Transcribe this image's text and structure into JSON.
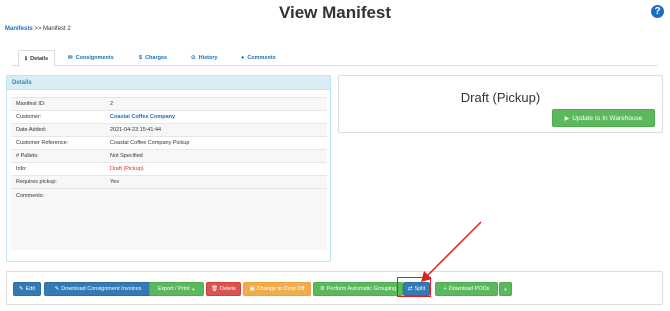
{
  "header": {
    "title": "View Manifest",
    "help_icon": "?"
  },
  "breadcrumb": {
    "link": "Manifests",
    "separator": ">>",
    "current": "Manifest 2"
  },
  "tabs": [
    {
      "label": "Details",
      "icon": "info-icon",
      "glyph": "ℹ",
      "active": true
    },
    {
      "label": "Consignments",
      "icon": "envelope-icon",
      "glyph": "✉",
      "active": false
    },
    {
      "label": "Charges",
      "icon": "dollar-icon",
      "glyph": "$",
      "active": false
    },
    {
      "label": "History",
      "icon": "clock-icon",
      "glyph": "⊙",
      "active": false
    },
    {
      "label": "Comments",
      "icon": "comment-icon",
      "glyph": "●",
      "active": false
    }
  ],
  "details": {
    "heading": "Details",
    "rows": [
      {
        "label": "Manifest ID:",
        "value": "2"
      },
      {
        "label": "Customer:",
        "value": "Coastal Coffee Company"
      },
      {
        "label": "Date Added:",
        "value": "2021-04-23 15:41:44"
      },
      {
        "label": "Customer Reference:",
        "value": "Coastal Coffee Company Pickup"
      },
      {
        "label": "# Pallets:",
        "value": "Not Specified"
      },
      {
        "label": "Info:",
        "value": "Draft (Pickup)"
      },
      {
        "label": "Requires pickup:",
        "value": "Yes"
      }
    ],
    "comments_label": "Comments:"
  },
  "status": {
    "text": "Draft (Pickup)",
    "update_button": "Update to In Warehouse"
  },
  "actions": {
    "edit": "Edit",
    "download_invoices": "Download Consignment Invoices",
    "export_print": "Export / Print",
    "delete": "Delete",
    "change_drop_off": "Change to Drop Off",
    "auto_grouping": "Perform Automatic Grouping",
    "split": "Split",
    "download_pods": "Download PODs"
  },
  "colors": {
    "link": "#1a6fc0",
    "primary": "#337ab7",
    "success": "#5cb85c",
    "danger": "#d9534f",
    "warning": "#f0ad4e",
    "panel_info": "#d9edf7",
    "annotation": "#e02020"
  }
}
